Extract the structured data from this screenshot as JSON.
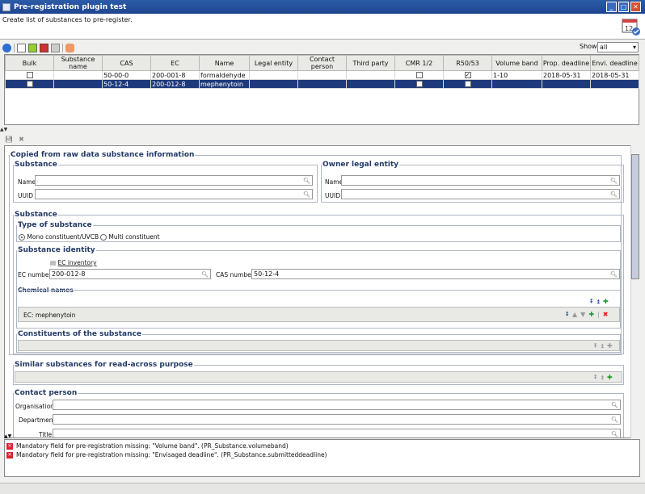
{
  "window": {
    "title": "Pre-registration plugin test",
    "desc": "Create list of substances to pre-register."
  },
  "toolbar": {
    "show_label": "Show",
    "show_value": "all"
  },
  "grid": {
    "headers": [
      "Bulk",
      "Substance name",
      "CAS",
      "EC",
      "Name",
      "Legal entity",
      "Contact person",
      "Third party",
      "CMR 1/2",
      "R50/53",
      "Volume band",
      "Prop. deadline",
      "Envi. deadline"
    ],
    "rows": [
      {
        "cas": "50-00-0",
        "ec": "200-001-8",
        "name": "formaldehyde",
        "r50": true,
        "volume": "1-10",
        "prop": "2018-05-31",
        "envi": "2018-05-31"
      },
      {
        "cas": "50-12-4",
        "ec": "200-012-8",
        "name": "mephenytoin",
        "r50": false,
        "volume": "",
        "prop": "",
        "envi": ""
      }
    ]
  },
  "form": {
    "copied_title": "Copied from raw data substance information",
    "substance_title": "Substance",
    "owner_title": "Owner legal entity",
    "name_label": "Name",
    "uuid_label": "UUID",
    "substance2_title": "Substance",
    "type_title": "Type of substance",
    "mono": "Mono constituent/UVCB",
    "multi": "Multi constituent",
    "identity_title": "Substance identity",
    "ec_inventory": "EC inventory",
    "ec_number_label": "EC number",
    "ec_number": "200-012-8",
    "cas_number_label": "CAS number",
    "cas_number": "50-12-4",
    "chem_names_title": "Chemical names",
    "chem_name": "EC: mephenytoin",
    "constituents_title": "Constituents of the substance",
    "similar_title": "Similar substances for read-across purpose",
    "contact_title": "Contact person",
    "organisation_label": "Organisation",
    "department_label": "Department",
    "title_label": "Title"
  },
  "messages": [
    "Mandatory field for pre-registration missing: \"Volume band\". (PR_Substance.volumeband)",
    "Mandatory field for pre-registration missing: \"Envisaged deadline\". (PR_Substance.submitteddeadline)"
  ],
  "icons": {
    "app": "app-icon",
    "calendar": "calendar-icon",
    "back": "back-arrow-icon",
    "new": "new-doc-icon",
    "save": "save-icon",
    "delete": "delete-icon"
  }
}
